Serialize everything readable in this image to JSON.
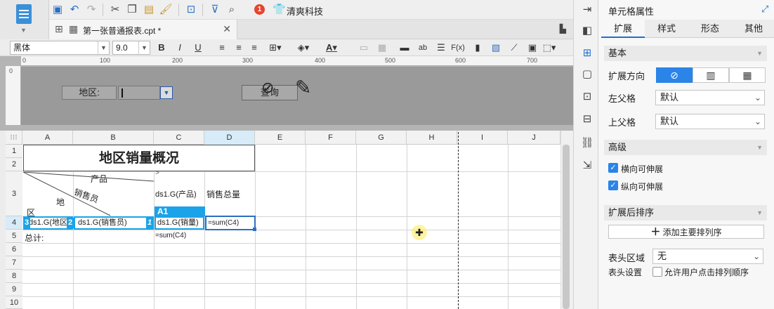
{
  "toolbar": {
    "company": "清爽科技",
    "badge": "1",
    "icons": [
      "save-icon",
      "undo-icon",
      "redo-icon",
      "cut-icon",
      "copy-icon",
      "paste-icon",
      "format-painter-icon",
      "preview-icon",
      "filter-icon",
      "search-doc-icon"
    ]
  },
  "tab": {
    "title": "第一张普通报表.cpt *"
  },
  "format": {
    "font": "黑体",
    "size": "9.0"
  },
  "ruler": {
    "ticks": [
      "0",
      "100",
      "200",
      "300",
      "400",
      "500",
      "600",
      "700"
    ]
  },
  "params": {
    "region_label": "地区:",
    "query_label": "查询"
  },
  "sheet": {
    "columns": [
      "A",
      "B",
      "C",
      "D",
      "E",
      "F",
      "G",
      "H",
      "I",
      "J"
    ],
    "rows": [
      "1",
      "2",
      "3",
      "4",
      "5",
      "6",
      "7",
      "8",
      "9",
      "10"
    ],
    "title": "地区销量概况",
    "cells": {
      "c3_arrow": ">",
      "diag_product": "产品",
      "diag_sales": "销售员",
      "diag_region1": "地",
      "diag_region2": "区",
      "c3": "ds1.G(产品)",
      "d3": "销售总量",
      "c3_name": "A1",
      "a4": "ds1.G(地区)",
      "a4_badge": "3",
      "b4": "ds1.G(销售员)",
      "b4_badge": "2",
      "b4_badge2": "1",
      "c4": "ds1.G(销量)",
      "d4": "=sum(C4)",
      "a5": "总计:",
      "c5": "=sum(C4)"
    }
  },
  "panel": {
    "title": "单元格属性",
    "tabs": [
      "扩展",
      "样式",
      "形态",
      "其他"
    ],
    "sections": {
      "basic": "基本",
      "advanced": "高级",
      "sort": "扩展后排序"
    },
    "expand_direction": "扩展方向",
    "left_parent": "左父格",
    "left_parent_value": "默认",
    "top_parent": "上父格",
    "top_parent_value": "默认",
    "h_expand": "横向可伸展",
    "v_expand": "纵向可伸展",
    "add_sort": "添加主要排列序",
    "header_area": "表头区域",
    "header_area_value": "无",
    "header_setting": "表头设置",
    "allow_sort": "允许用户点击排列顺序"
  }
}
